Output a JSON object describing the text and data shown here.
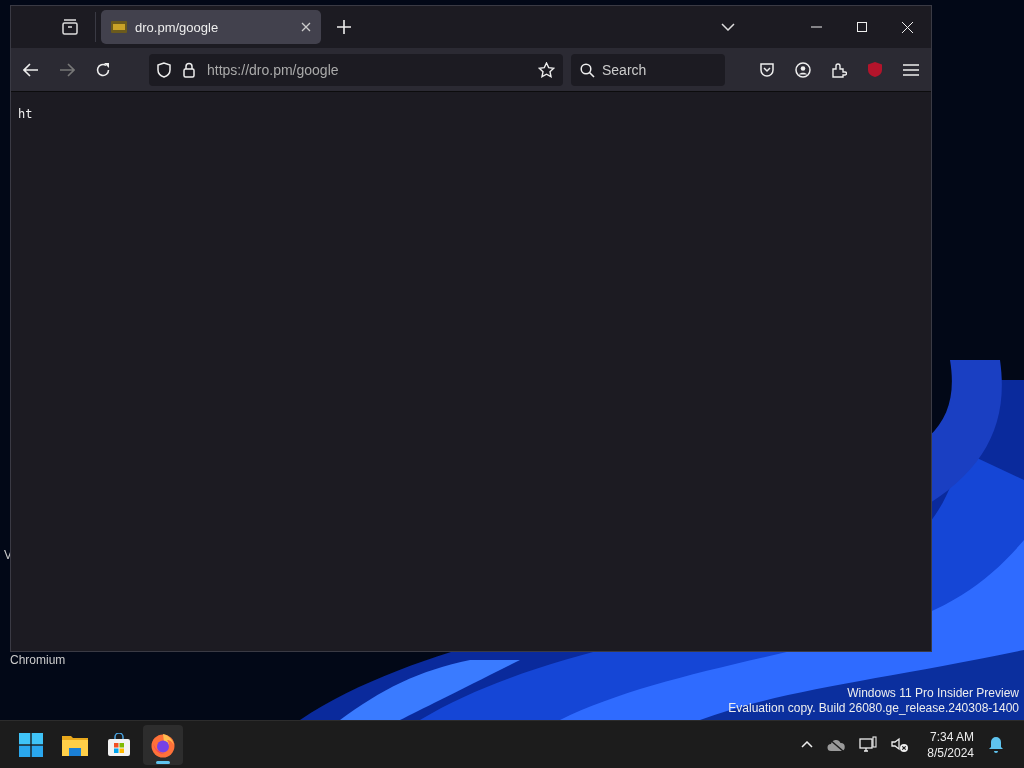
{
  "desktop": {
    "icon_labels": [
      "V",
      "Chromium"
    ],
    "watermark": [
      "Windows 11 Pro Insider Preview",
      "Evaluation copy. Build 26080.ge_release.240308-1400"
    ]
  },
  "browser": {
    "tabs": [
      {
        "title": "dro.pm/google",
        "selected": true
      }
    ],
    "nav": {
      "back_disabled": false,
      "forward_disabled": true
    },
    "address": "https://dro.pm/google",
    "search": {
      "placeholder": "Search"
    },
    "page_text": "ht"
  },
  "taskbar": {
    "apps": [
      {
        "kind": "start",
        "active": false
      },
      {
        "kind": "explorer",
        "active": false
      },
      {
        "kind": "store",
        "active": false
      },
      {
        "kind": "firefox",
        "active": true
      }
    ],
    "clock": {
      "time": "7:34 AM",
      "date": "8/5/2024"
    }
  }
}
